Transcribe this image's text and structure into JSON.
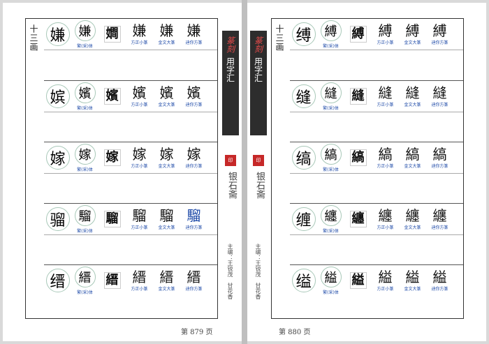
{
  "book": {
    "spine_title_stylized": "篆刻",
    "spine_title": "用字汇",
    "brand": "银石斋",
    "editors": "主编：王锐茂　甘花香",
    "seal_text": "印"
  },
  "captions": [
    "繁(采)体",
    "方正小篆",
    "金文大篆",
    "迪你方篆"
  ],
  "left": {
    "stroke_label": "十三画",
    "footer": "第 879 页",
    "rows": [
      {
        "char": "嫌",
        "trad": "嫌",
        "g1": "𡢃",
        "g2": "嫌",
        "g3": "嫌",
        "g4": "嫌"
      },
      {
        "char": "嫔",
        "trad": "嬪",
        "g1": "嬪",
        "g2": "嬪",
        "g3": "嬪",
        "g4": "嬪"
      },
      {
        "char": "嫁",
        "trad": "嫁",
        "g1": "嫁",
        "g2": "嫁",
        "g3": "嫁",
        "g4": "嫁"
      },
      {
        "char": "骝",
        "trad": "騮",
        "g1": "騮",
        "g2": "騮",
        "g3": "騮",
        "g4": "騮"
      },
      {
        "char": "缙",
        "trad": "縉",
        "g1": "縉",
        "g2": "縉",
        "g3": "縉",
        "g4": "縉"
      }
    ]
  },
  "right": {
    "stroke_label": "十三画",
    "footer": "第 880 页",
    "rows": [
      {
        "char": "缚",
        "trad": "縛",
        "g1": "縛",
        "g2": "縛",
        "g3": "縛",
        "g4": "縛"
      },
      {
        "char": "缝",
        "trad": "縫",
        "g1": "縫",
        "g2": "縫",
        "g3": "縫",
        "g4": "縫"
      },
      {
        "char": "缟",
        "trad": "縞",
        "g1": "縞",
        "g2": "縞",
        "g3": "縞",
        "g4": "縞"
      },
      {
        "char": "缠",
        "trad": "纏",
        "g1": "纏",
        "g2": "纏",
        "g3": "纏",
        "g4": "纏"
      },
      {
        "char": "缢",
        "trad": "縊",
        "g1": "縊",
        "g2": "縊",
        "g3": "縊",
        "g4": "縊"
      }
    ]
  }
}
